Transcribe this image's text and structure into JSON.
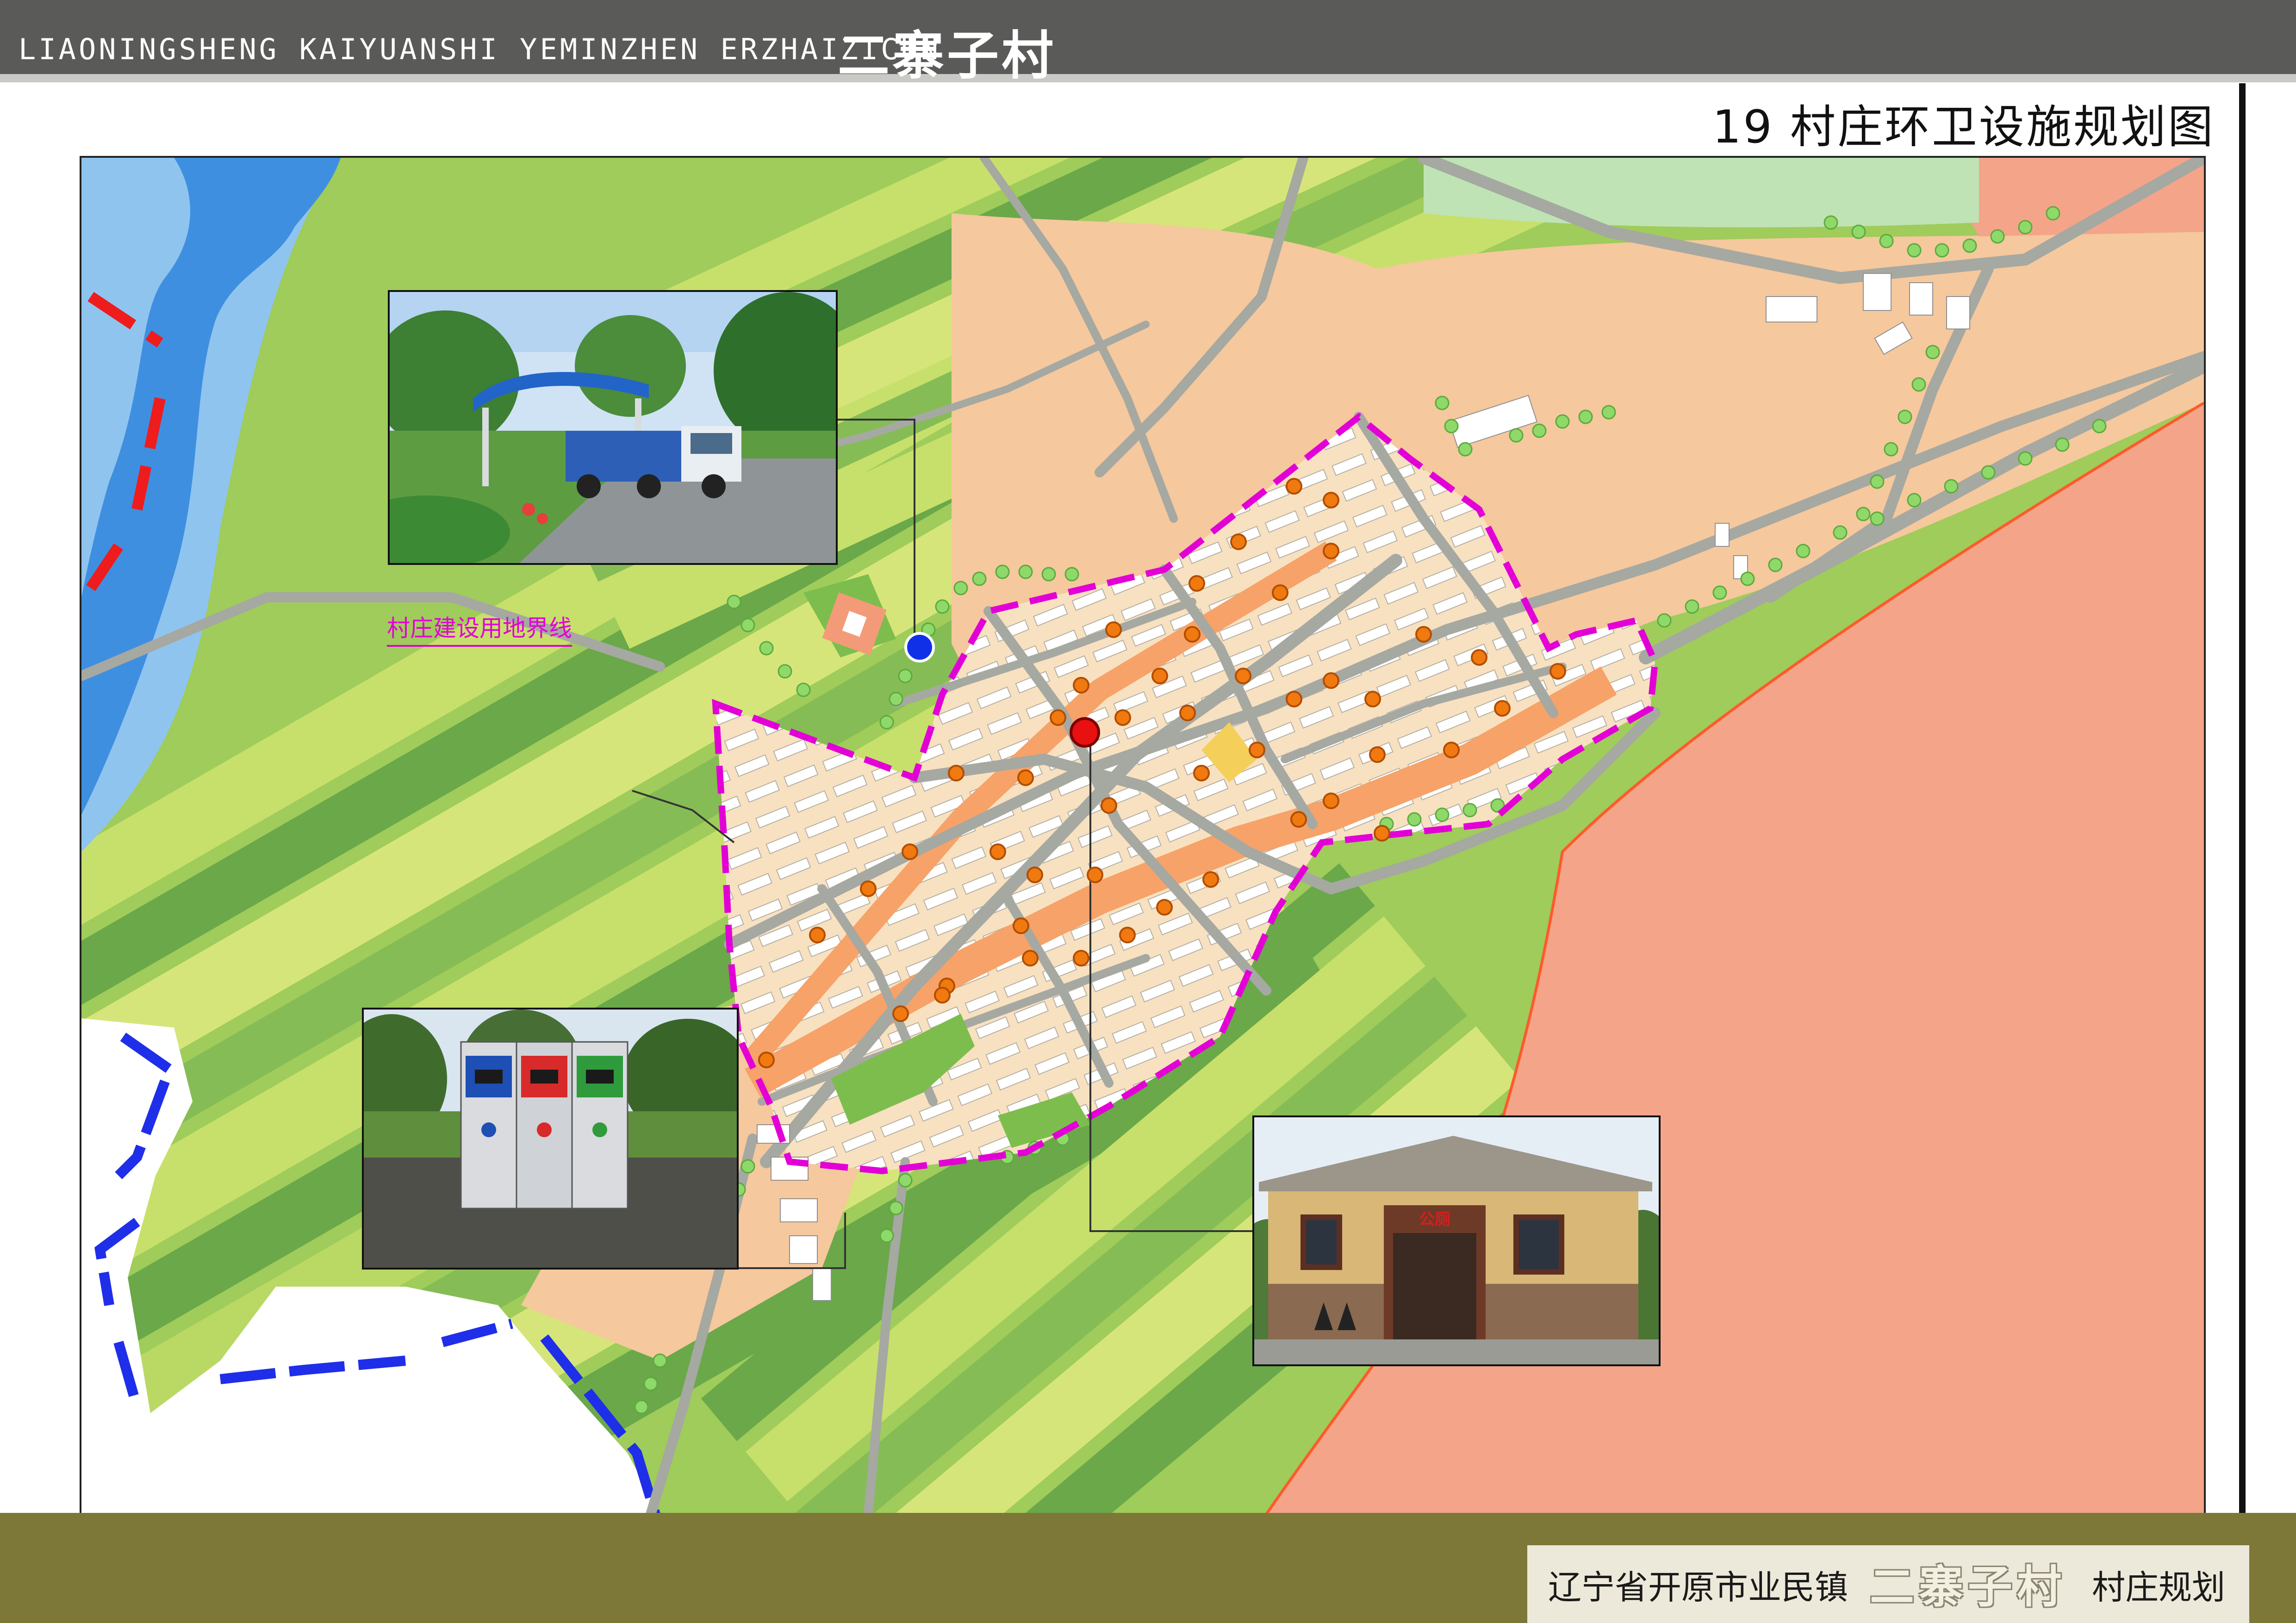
{
  "header": {
    "latin_title": "LIAONINGSHENG KAIYUANSHI YEMINZHEN ERZHAIZICUN",
    "chinese_title": "二寨子村"
  },
  "sheet": {
    "title": "19 村庄环卫设施规划图"
  },
  "map": {
    "boundary_label": "村庄建设用地界线",
    "toilet_sign": "公厕",
    "colors": {
      "water_dark": "#3f8fe0",
      "water_light": "#8fc4ef",
      "farmland_light": "#c7e06b",
      "farmland_mid": "#9fcc5a",
      "farmland_dark": "#6aa84a",
      "construction_zone": "#f5c89d",
      "industrial_zone": "#f4a489",
      "village_ground": "#f8e1c0",
      "road": "#a6a8a2",
      "boundary": "#e200d6",
      "trash_point": "#f07a10",
      "transfer_station": "#1030e8",
      "public_toilet": "#e81010"
    }
  },
  "footer": {
    "location": "辽宁省开原市业民镇",
    "village": "二寨子村",
    "suffix": "村庄规划"
  }
}
